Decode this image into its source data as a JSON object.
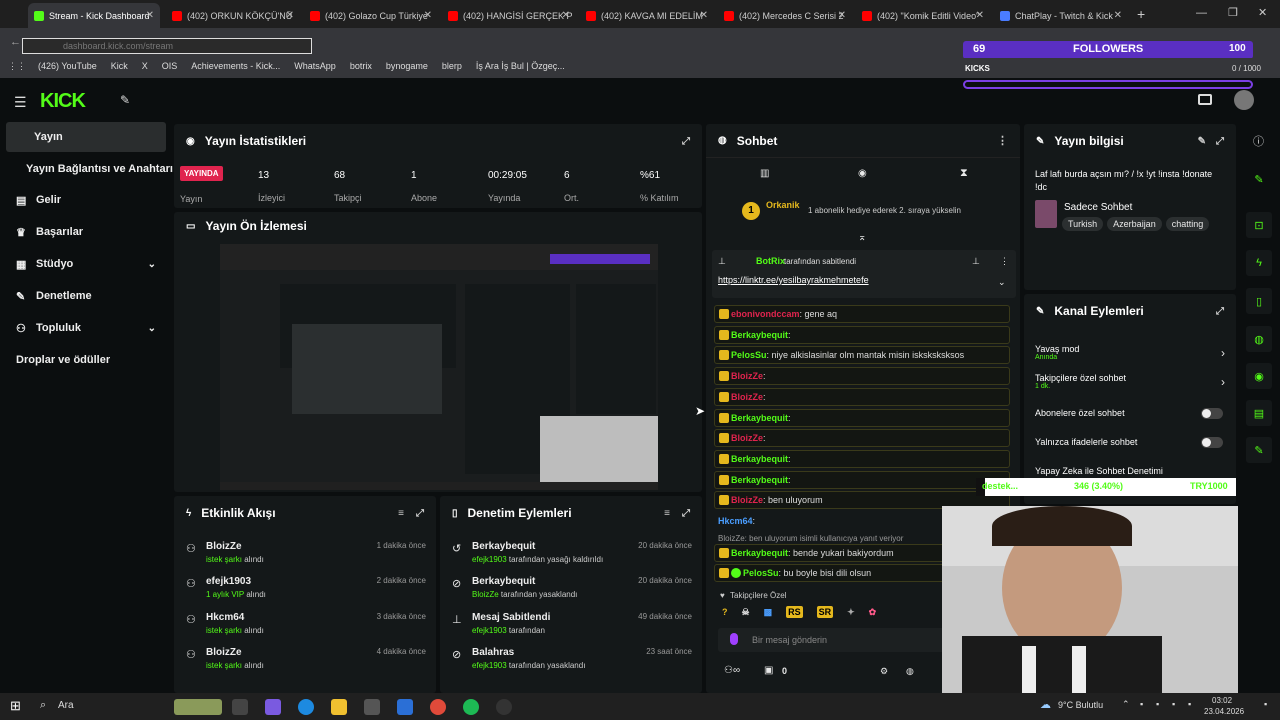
{
  "browser": {
    "tabs": [
      {
        "label": "Stream - Kick Dashboard",
        "active": true,
        "color": "#53fc18"
      },
      {
        "label": "(402) ORKUN KÖKÇÜ'NÜ",
        "color": "#ff0000"
      },
      {
        "label": "(402) Golazo Cup Türkiye",
        "color": "#ff0000"
      },
      {
        "label": "(402) HANGİSİ GERÇEK P",
        "color": "#ff0000"
      },
      {
        "label": "(402) KAVGA MI EDELİM",
        "color": "#ff0000"
      },
      {
        "label": "(402) Mercedes C Serisi 2",
        "color": "#ff0000"
      },
      {
        "label": "(402) \"Komik Editli Video\"",
        "color": "#ff0000"
      },
      {
        "label": "ChatPlay - Twitch & Kick",
        "color": "#4a7cff"
      }
    ],
    "url": "dashboard.kick.com/stream",
    "bookmarks": [
      "(426) YouTube",
      "Kick",
      "X",
      "OIS",
      "Achievements - Kick...",
      "WhatsApp",
      "botrix",
      "bynogame",
      "blerp",
      "İş Ara İş Bul | Özgeç..."
    ],
    "followers_overlay": {
      "count": "69",
      "label": "FOLLOWERS",
      "right_value": "100",
      "sub_left": "KICKS",
      "sub_right": "0 / 1000"
    }
  },
  "sidebar": {
    "items": [
      {
        "label": "Yayın",
        "active": true
      },
      {
        "label": "Yayın Bağlantısı ve Anahtarı"
      },
      {
        "label": "Gelir"
      },
      {
        "label": "Başarılar"
      },
      {
        "label": "Stüdyo",
        "has_chevron": true
      },
      {
        "label": "Denetleme"
      },
      {
        "label": "Topluluk",
        "has_chevron": true
      },
      {
        "label": "Droplar ve ödüller"
      }
    ]
  },
  "stats": {
    "title": "Yayın İstatistikleri",
    "live_badge": "YAYINDA",
    "live_label": "Yayın",
    "items": [
      {
        "value": "13",
        "label": "İzleyici"
      },
      {
        "value": "68",
        "label": "Takipçi"
      },
      {
        "value": "1",
        "label": "Abone"
      },
      {
        "value": "00:29:05",
        "label": "Yayında"
      },
      {
        "value": "6",
        "label": "Ort."
      },
      {
        "value": "%61",
        "label": "% Katılım"
      }
    ]
  },
  "preview": {
    "title": "Yayın Ön İzlemesi"
  },
  "activity": {
    "title": "Etkinlik Akışı",
    "events": [
      {
        "name": "BloizZe",
        "detail": "istek şarkı",
        "suffix": " alındı",
        "time": "1 dakika önce"
      },
      {
        "name": "efejk1903",
        "detail": "1 aylık VIP",
        "suffix": " alındı",
        "time": "2 dakika önce"
      },
      {
        "name": "Hkcm64",
        "detail": "istek şarkı",
        "suffix": " alındı",
        "time": "3 dakika önce"
      },
      {
        "name": "BloizZe",
        "detail": "istek şarkı",
        "suffix": " alındı",
        "time": "4 dakika önce"
      }
    ]
  },
  "moderation": {
    "title": "Denetim Eylemleri",
    "events": [
      {
        "name": "Berkaybequit",
        "detail": "efejk1903",
        "suffix": " tarafından yasağı kaldırıldı",
        "time": "20 dakika önce"
      },
      {
        "name": "Berkaybequit",
        "detail": "BloizZe",
        "suffix": " tarafından yasaklandı",
        "time": "20 dakika önce"
      },
      {
        "name": "Mesaj Sabitlendi",
        "detail": "efejk1903",
        "suffix": " tarafından",
        "time": "49 dakika önce"
      },
      {
        "name": "Balahras",
        "detail": "efejk1903",
        "suffix": " tarafından yasaklandı",
        "time": "23 saat önce"
      }
    ]
  },
  "chat": {
    "title": "Sohbet",
    "top_user": "Orkanik",
    "top_user_count": "1",
    "top_message": "1 abonelik hediye ederek 2. sıraya yükselin",
    "pinned_by": "BotRix",
    "pinned_by_suffix": "tarafından sabitlendi",
    "pinned_link": "https://linktr.ee/yesilbayrakmehmetefe",
    "messages": [
      {
        "user": "ebonivondccam",
        "text": "gene aq",
        "color": "#e0244e"
      },
      {
        "user": "Berkaybequit",
        "text": "",
        "color": "#53fc18"
      },
      {
        "user": "PelosSu",
        "text": "niye alkislasinlar olm mantak misin isksksksksos",
        "color": "#53fc18"
      },
      {
        "user": "BloizZe",
        "text": "",
        "color": "#e0244e"
      },
      {
        "user": "BloizZe",
        "text": "",
        "color": "#e0244e"
      },
      {
        "user": "Berkaybequit",
        "text": "",
        "color": "#53fc18"
      },
      {
        "user": "BloizZe",
        "text": "",
        "color": "#e0244e"
      },
      {
        "user": "Berkaybequit",
        "text": "",
        "color": "#53fc18"
      },
      {
        "user": "Berkaybequit",
        "text": "",
        "color": "#53fc18"
      },
      {
        "user": "BloizZe",
        "text": "ben uluyorum",
        "color": "#e0244e"
      },
      {
        "user": "Hkcm64",
        "text": "",
        "color": "#4a9eff"
      }
    ],
    "reply_context": "BloizZe: ben uluyorum isimli kullanıcıya yanıt veriyor",
    "reply_messages": [
      {
        "user": "Berkaybequit",
        "text": "bende yukari bakiyordum",
        "color": "#53fc18"
      },
      {
        "user": "PelosSu",
        "text": "bu boyle bisi dili olsun",
        "color": "#53fc18"
      }
    ],
    "followers_only": "Takipçilere Özel",
    "emote_labels": [
      "?",
      "RS",
      "SR"
    ],
    "input_placeholder": "Bir mesaj gönderin",
    "footer_count": "0"
  },
  "stream_info": {
    "title": "Yayın bilgisi",
    "stream_title": "Laf lafı burda açsın mı? / !x !yt !insta !donate !dc",
    "category": "Sadece Sohbet",
    "tags": [
      "Turkish",
      "Azerbaijan",
      "chatting"
    ]
  },
  "channel_actions": {
    "title": "Kanal Eylemleri",
    "items": [
      {
        "label": "Yavaş mod",
        "sub": "Anında",
        "type": "chevron"
      },
      {
        "label": "Takipçilere özel sohbet",
        "sub": "1 dk.",
        "type": "chevron"
      },
      {
        "label": "Abonelere özel sohbet",
        "type": "toggle"
      },
      {
        "label": "Yalnızca ifadelerle sohbet",
        "type": "toggle"
      },
      {
        "label": "Yapay Zeka ile Sohbet Denetimi",
        "type": "link"
      }
    ]
  },
  "donation_bar": {
    "left": "destek...",
    "mid": "346 (3.40%)",
    "right": "TRY1000"
  },
  "taskbar": {
    "search": "Ara",
    "weather": "9°C Bulutlu",
    "time": "03:02",
    "date": "23.04.2026"
  },
  "colors": {
    "accent": "#53fc18",
    "live": "#e0244e",
    "bg": "#0b0e0f",
    "panel": "#141819"
  }
}
